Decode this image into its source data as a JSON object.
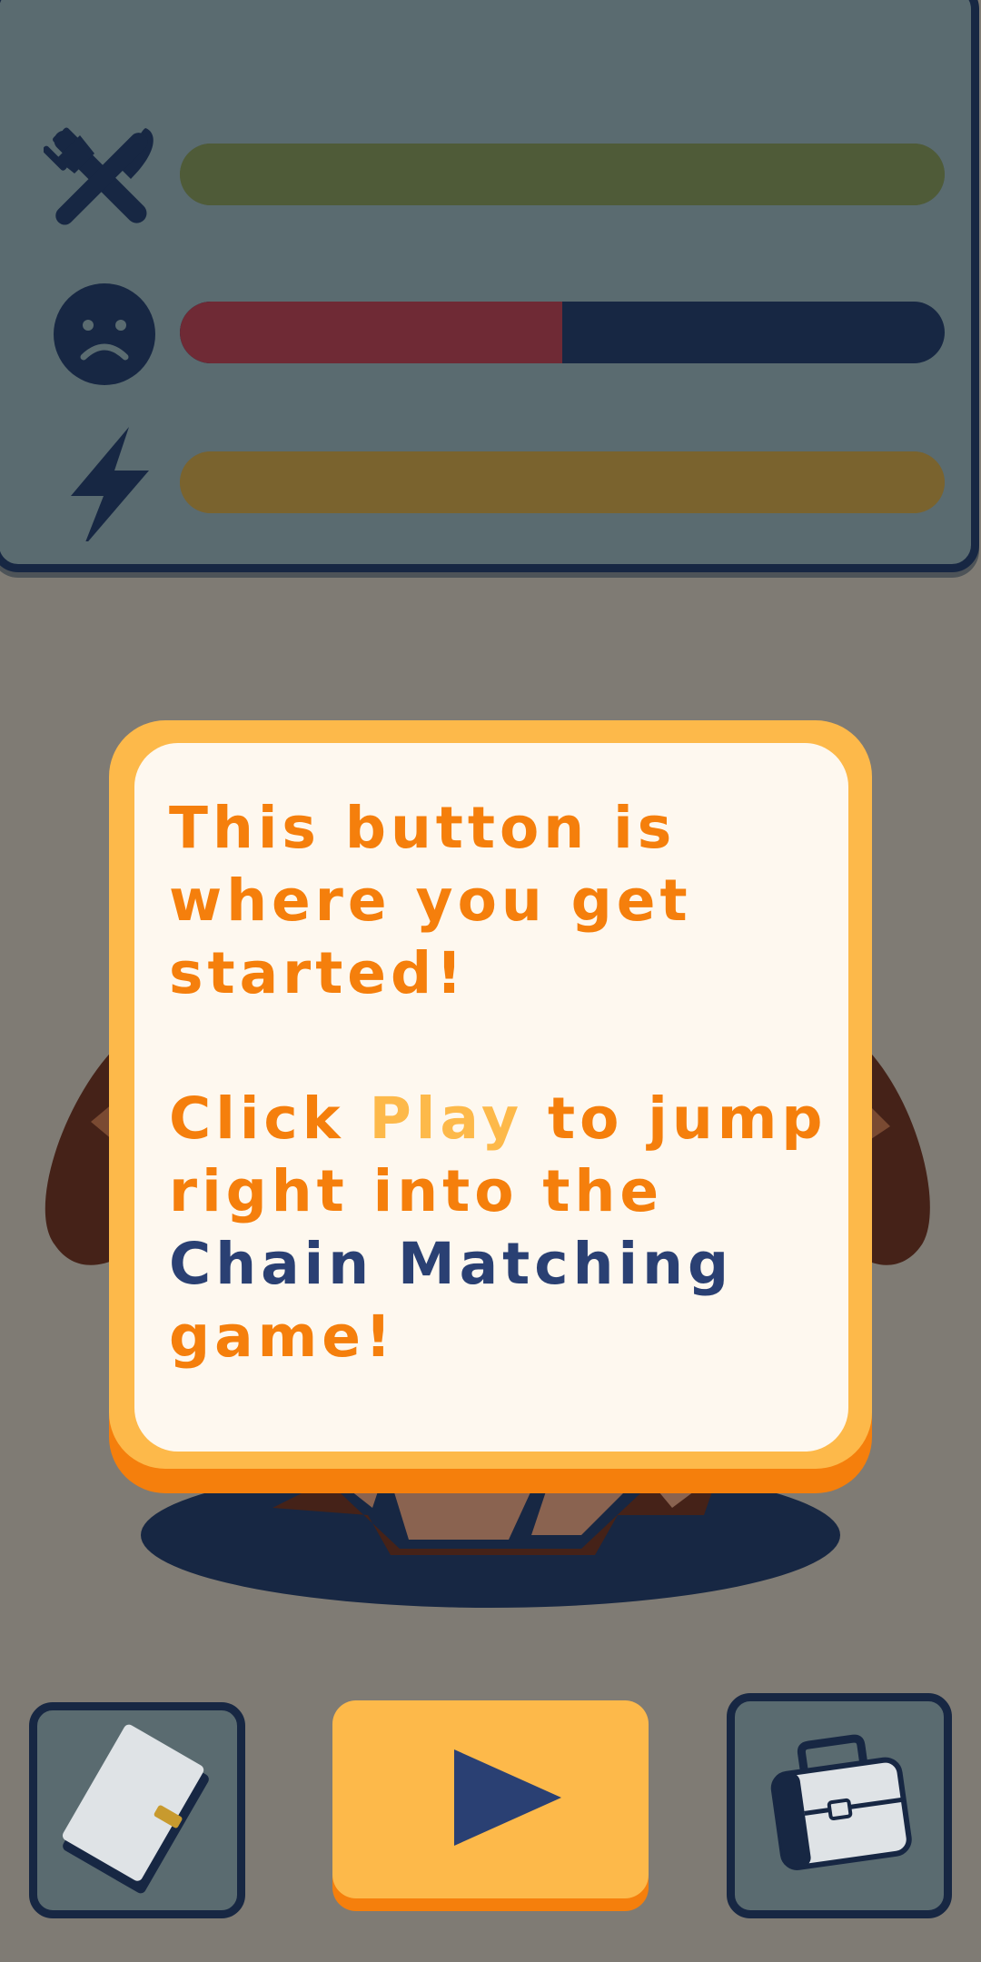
{
  "stats": [
    {
      "name": "hunger",
      "icon": "fork-knife-icon",
      "value": 1.0,
      "color": "#4f5b38"
    },
    {
      "name": "happiness",
      "icon": "sad-face-icon",
      "value": 0.5,
      "color": "#6f2a35"
    },
    {
      "name": "energy",
      "icon": "lightning-icon",
      "value": 1.0,
      "color": "#7a632e"
    }
  ],
  "dialog": {
    "line1": "This button is where you get started!",
    "click": "Click ",
    "play_word": "Play",
    "after_play": " to jump right into the ",
    "game_name": "Chain Matching",
    "end": " game!"
  },
  "buttons": {
    "left_icon": "notebook-icon",
    "center_icon": "play-icon",
    "right_icon": "suitcase-icon"
  },
  "colors": {
    "accent_orange": "#f57f0c",
    "accent_yellow": "#fdb94a",
    "navy": "#172743"
  }
}
